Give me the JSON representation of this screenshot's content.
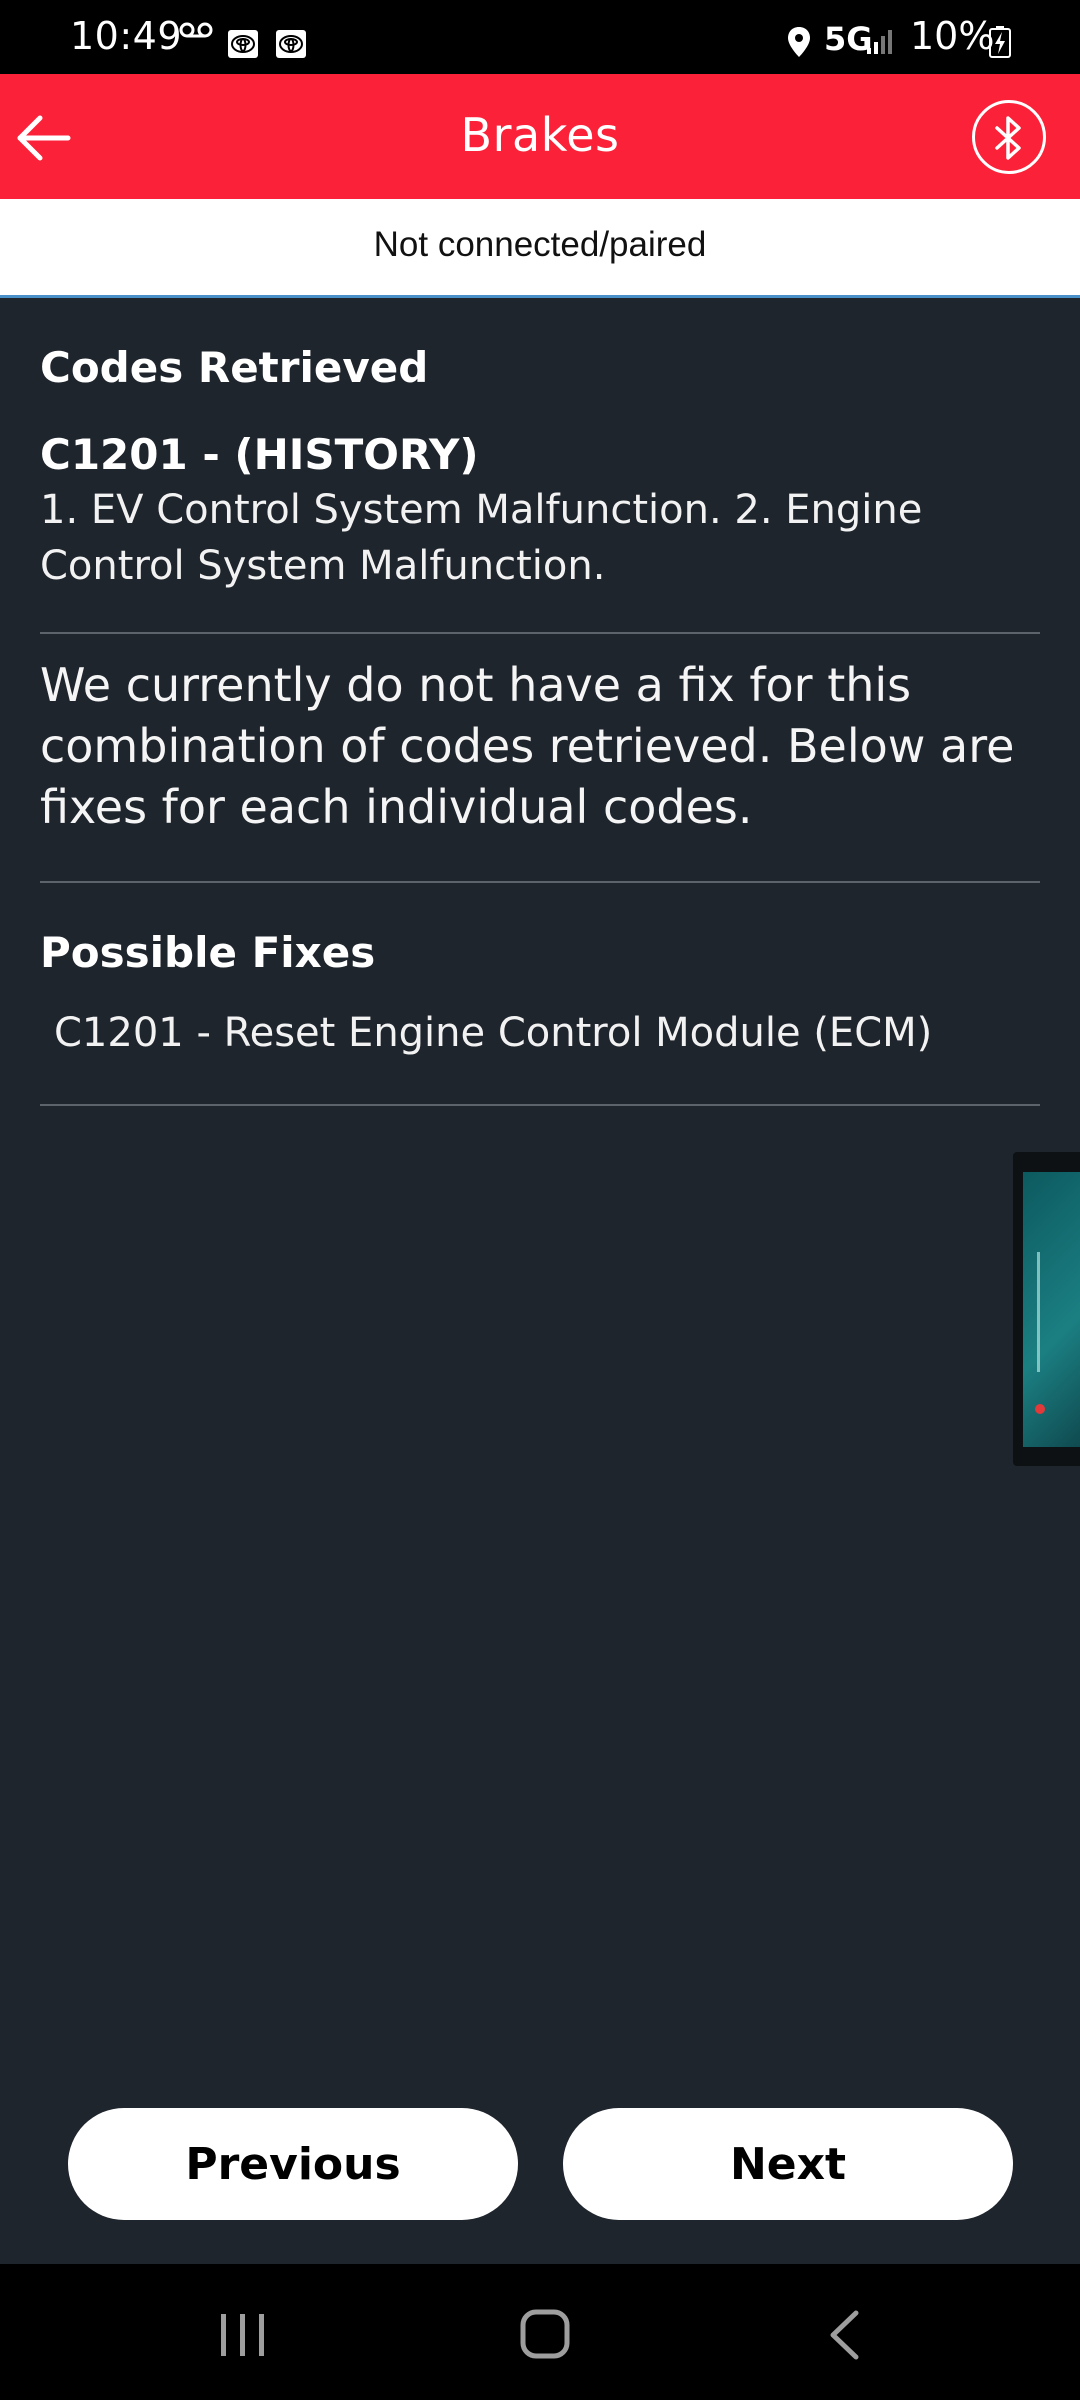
{
  "status_bar": {
    "time": "10:49",
    "network": "5G",
    "battery": "10%",
    "icons": [
      "voicemail-icon",
      "toyota-app-icon",
      "toyota-app-icon",
      "location-icon",
      "signal-icon",
      "battery-charging-icon"
    ]
  },
  "header": {
    "title": "Brakes",
    "back_icon": "arrow-left-icon",
    "bluetooth_icon": "bluetooth-icon",
    "color": "#fb2138"
  },
  "connection": {
    "status": "Not connected/paired"
  },
  "codes": {
    "heading": "Codes Retrieved",
    "items": [
      {
        "code": "C1201 - (HISTORY)",
        "description": "1. EV Control System Malfunction. 2. Engine Control System Malfunction."
      }
    ]
  },
  "message": "We currently do not have a fix for this combination of codes retrieved. Below are fixes for each individual codes.",
  "fixes": {
    "heading": "Possible Fixes",
    "items": [
      "C1201 - Reset Engine Control Module (ECM)"
    ]
  },
  "buttons": {
    "previous": "Previous",
    "next": "Next"
  },
  "theme": {
    "background": "#1f252d",
    "accent": "#fb2138"
  }
}
